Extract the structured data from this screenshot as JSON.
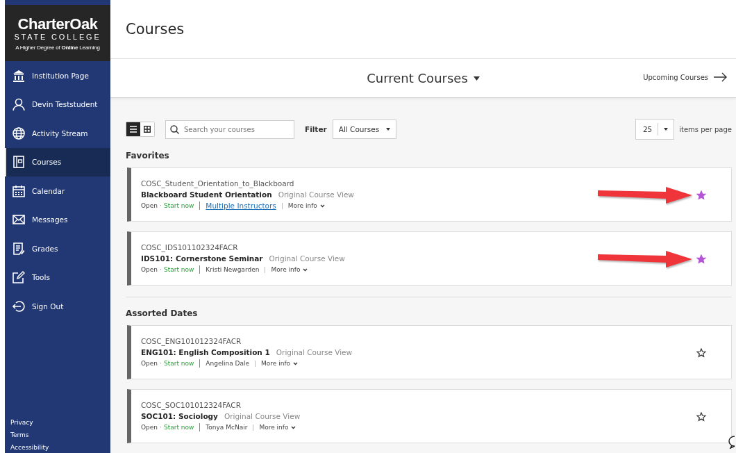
{
  "logo": {
    "name": "CharterOak",
    "subtitle": "STATE COLLEGE",
    "tagline": "A Higher Degree of **Online** Learning"
  },
  "sidebar": {
    "items": [
      {
        "label": "Institution Page",
        "selected": false
      },
      {
        "label": "Devin Teststudent",
        "selected": false
      },
      {
        "label": "Activity Stream",
        "selected": false
      },
      {
        "label": "Courses",
        "selected": true
      },
      {
        "label": "Calendar",
        "selected": false
      },
      {
        "label": "Messages",
        "selected": false
      },
      {
        "label": "Grades",
        "selected": false
      },
      {
        "label": "Tools",
        "selected": false
      },
      {
        "label": "Sign Out",
        "selected": false
      }
    ],
    "footer_links": [
      "Privacy",
      "Terms",
      "Accessibility"
    ]
  },
  "page_title": "Courses",
  "term_bar": {
    "current": "Current Courses",
    "next": "Upcoming Courses"
  },
  "toolbar": {
    "views": [
      {
        "kind": "list",
        "selected": true
      },
      {
        "kind": "grid",
        "selected": false
      }
    ],
    "search": {
      "placeholder": "Search your courses"
    },
    "filter_label": "Filter",
    "filter_value": "All Courses",
    "page_size": "25",
    "page_size_label": "items per page"
  },
  "sections": [
    {
      "title": "Favorites",
      "courses": [
        {
          "id": "COSC_Student_Orientation_to_Blackboard",
          "name": "Blackboard Student Orientation",
          "view": "Original Course View",
          "status": "Open",
          "separator": "·",
          "action": "Start now",
          "instructor": "Multiple Instructors",
          "instructor_link": true,
          "more": "More info",
          "favorite": true,
          "annotated": true
        },
        {
          "id": "COSC_IDS101102324FACR",
          "name": "IDS101: Cornerstone Seminar",
          "view": "Original Course View",
          "status": "Open",
          "separator": "·",
          "action": "Start now",
          "instructor": "Kristi Newgarden",
          "instructor_link": false,
          "more": "More info",
          "favorite": true,
          "annotated": true
        }
      ]
    },
    {
      "title": "Assorted Dates",
      "courses": [
        {
          "id": "COSC_ENG101012324FACR",
          "name": "ENG101: English Composition 1",
          "view": "Original Course View",
          "status": "Open",
          "separator": "·",
          "action": "Start now",
          "instructor": "Angelina Dale",
          "instructor_link": false,
          "more": "More info",
          "favorite": false,
          "annotated": false
        },
        {
          "id": "COSC_SOC101012324FACR",
          "name": "SOC101: Sociology",
          "view": "Original Course View",
          "status": "Open",
          "separator": "·",
          "action": "Start now",
          "instructor": "Tonya McNair",
          "instructor_link": false,
          "more": "More info",
          "favorite": false,
          "annotated": false
        }
      ]
    }
  ]
}
